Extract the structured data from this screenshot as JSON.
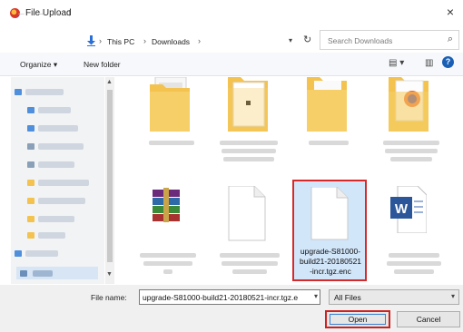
{
  "window": {
    "title": "File Upload",
    "close_glyph": "×"
  },
  "nav": {
    "back": "←",
    "forward": "→",
    "recent": "⌄",
    "up": "↑"
  },
  "address": {
    "crumbs": [
      "This PC",
      "Downloads"
    ],
    "separator": "›"
  },
  "search": {
    "placeholder": "Search Downloads"
  },
  "toolbar": {
    "organize": "Organize ▾",
    "new_folder": "New folder"
  },
  "files": {
    "selected_name": "upgrade-S81000-build21-20180521-incr.tgz.enc",
    "selected_label_lines": [
      "upgrade-S81000-",
      "build21-20180521",
      "-incr.tgz.enc"
    ]
  },
  "icons": [
    "app-icon",
    "close-icon",
    "back-icon",
    "forward-icon",
    "up-icon",
    "downloads-icon",
    "refresh-icon",
    "search-icon",
    "view-icon",
    "preview-pane-icon",
    "help-icon",
    "folder-icon",
    "archive-icon",
    "document-icon",
    "word-icon"
  ],
  "footer": {
    "file_name_label": "File name:",
    "file_name_value": "upgrade-S81000-build21-20180521-incr.tgz.e",
    "file_type": "All Files",
    "open_label": "Open",
    "cancel_label": "Cancel"
  },
  "colors": {
    "highlight": "#d62a2a",
    "selection": "#d2e6fa",
    "accent": "#2a6fd6",
    "folder": "#f3c24f"
  }
}
